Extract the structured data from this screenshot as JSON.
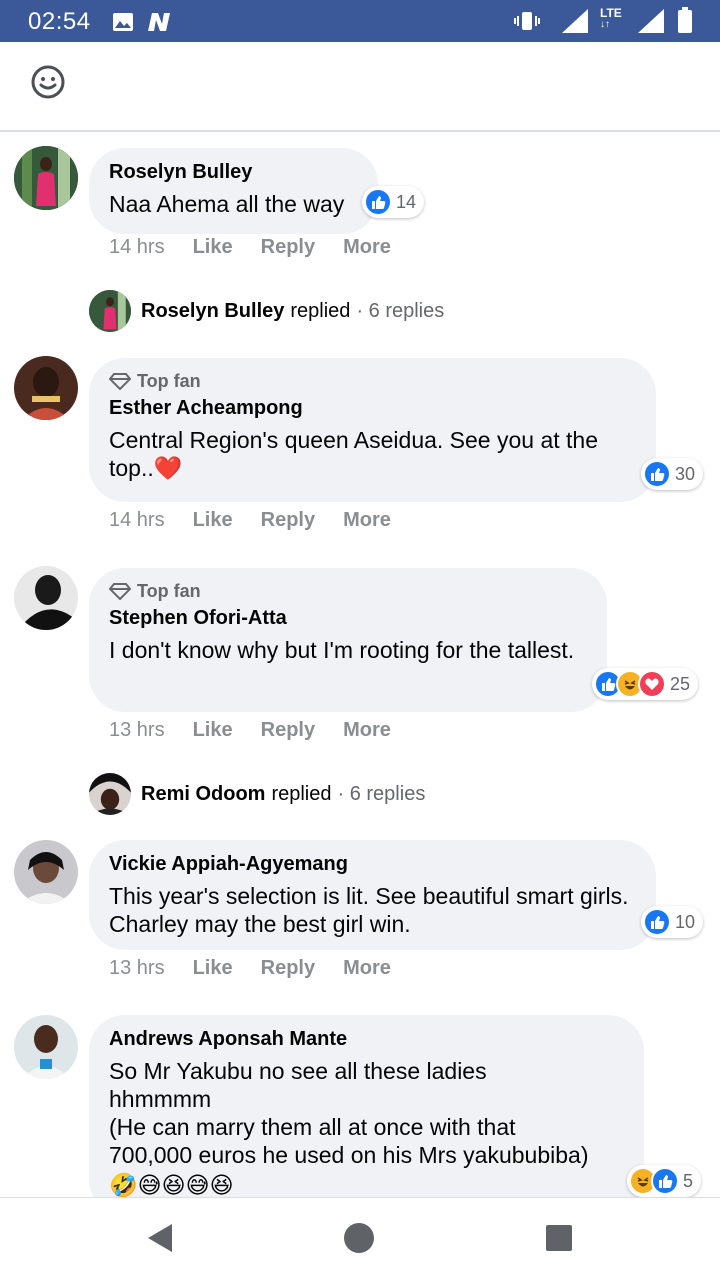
{
  "status_bar": {
    "time": "02:54",
    "network": "LTE",
    "bg_color": "#3b5998"
  },
  "toolbar": {
    "emoji_icon": "smiley-icon"
  },
  "comments": [
    {
      "author": "Roselyn Bulley",
      "top_fan": "",
      "text": "Naa Ahema all the way",
      "reactions": [
        "like"
      ],
      "reaction_count": "14",
      "time": "14 hrs",
      "like": "Like",
      "reply": "Reply",
      "more": "More"
    },
    {
      "author": "Esther Acheampong",
      "top_fan": "Top fan",
      "text": "Central Region's queen Aseidua. See you at the top..❤️",
      "reactions": [
        "like"
      ],
      "reaction_count": "30",
      "time": "14 hrs",
      "like": "Like",
      "reply": "Reply",
      "more": "More"
    },
    {
      "author": "Stephen Ofori-Atta",
      "top_fan": "Top fan",
      "text": "I don't know why but I'm rooting for the tallest.",
      "reactions": [
        "like",
        "haha",
        "love"
      ],
      "reaction_count": "25",
      "time": "13 hrs",
      "like": "Like",
      "reply": "Reply",
      "more": "More"
    },
    {
      "author": "Vickie Appiah-Agyemang",
      "top_fan": "",
      "text": "This year's selection is lit. See beautiful smart girls. Charley may the best girl win.",
      "reactions": [
        "like"
      ],
      "reaction_count": "10",
      "time": "13 hrs",
      "like": "Like",
      "reply": "Reply",
      "more": "More"
    },
    {
      "author": "Andrews Aponsah Mante",
      "top_fan": "",
      "text_lines": [
        "So Mr Yakubu no see all these ladies",
        "hhmmmm",
        "(He can marry them all at once with that",
        "700,000 euros he used on his Mrs yakububiba)"
      ],
      "emojis": "🤣😅😆😅😆",
      "reactions": [
        "haha",
        "like"
      ],
      "reaction_count": "5"
    }
  ],
  "reply_threads": [
    {
      "name": "Roselyn Bulley",
      "word": "replied",
      "count": "· 6 replies"
    },
    {
      "name": "Remi Odoom",
      "word": "replied",
      "count": "· 6 replies"
    }
  ],
  "colors": {
    "like": "#1877f2",
    "haha": "#f7b125",
    "love": "#f33e58",
    "bubble": "#f0f2f5"
  }
}
